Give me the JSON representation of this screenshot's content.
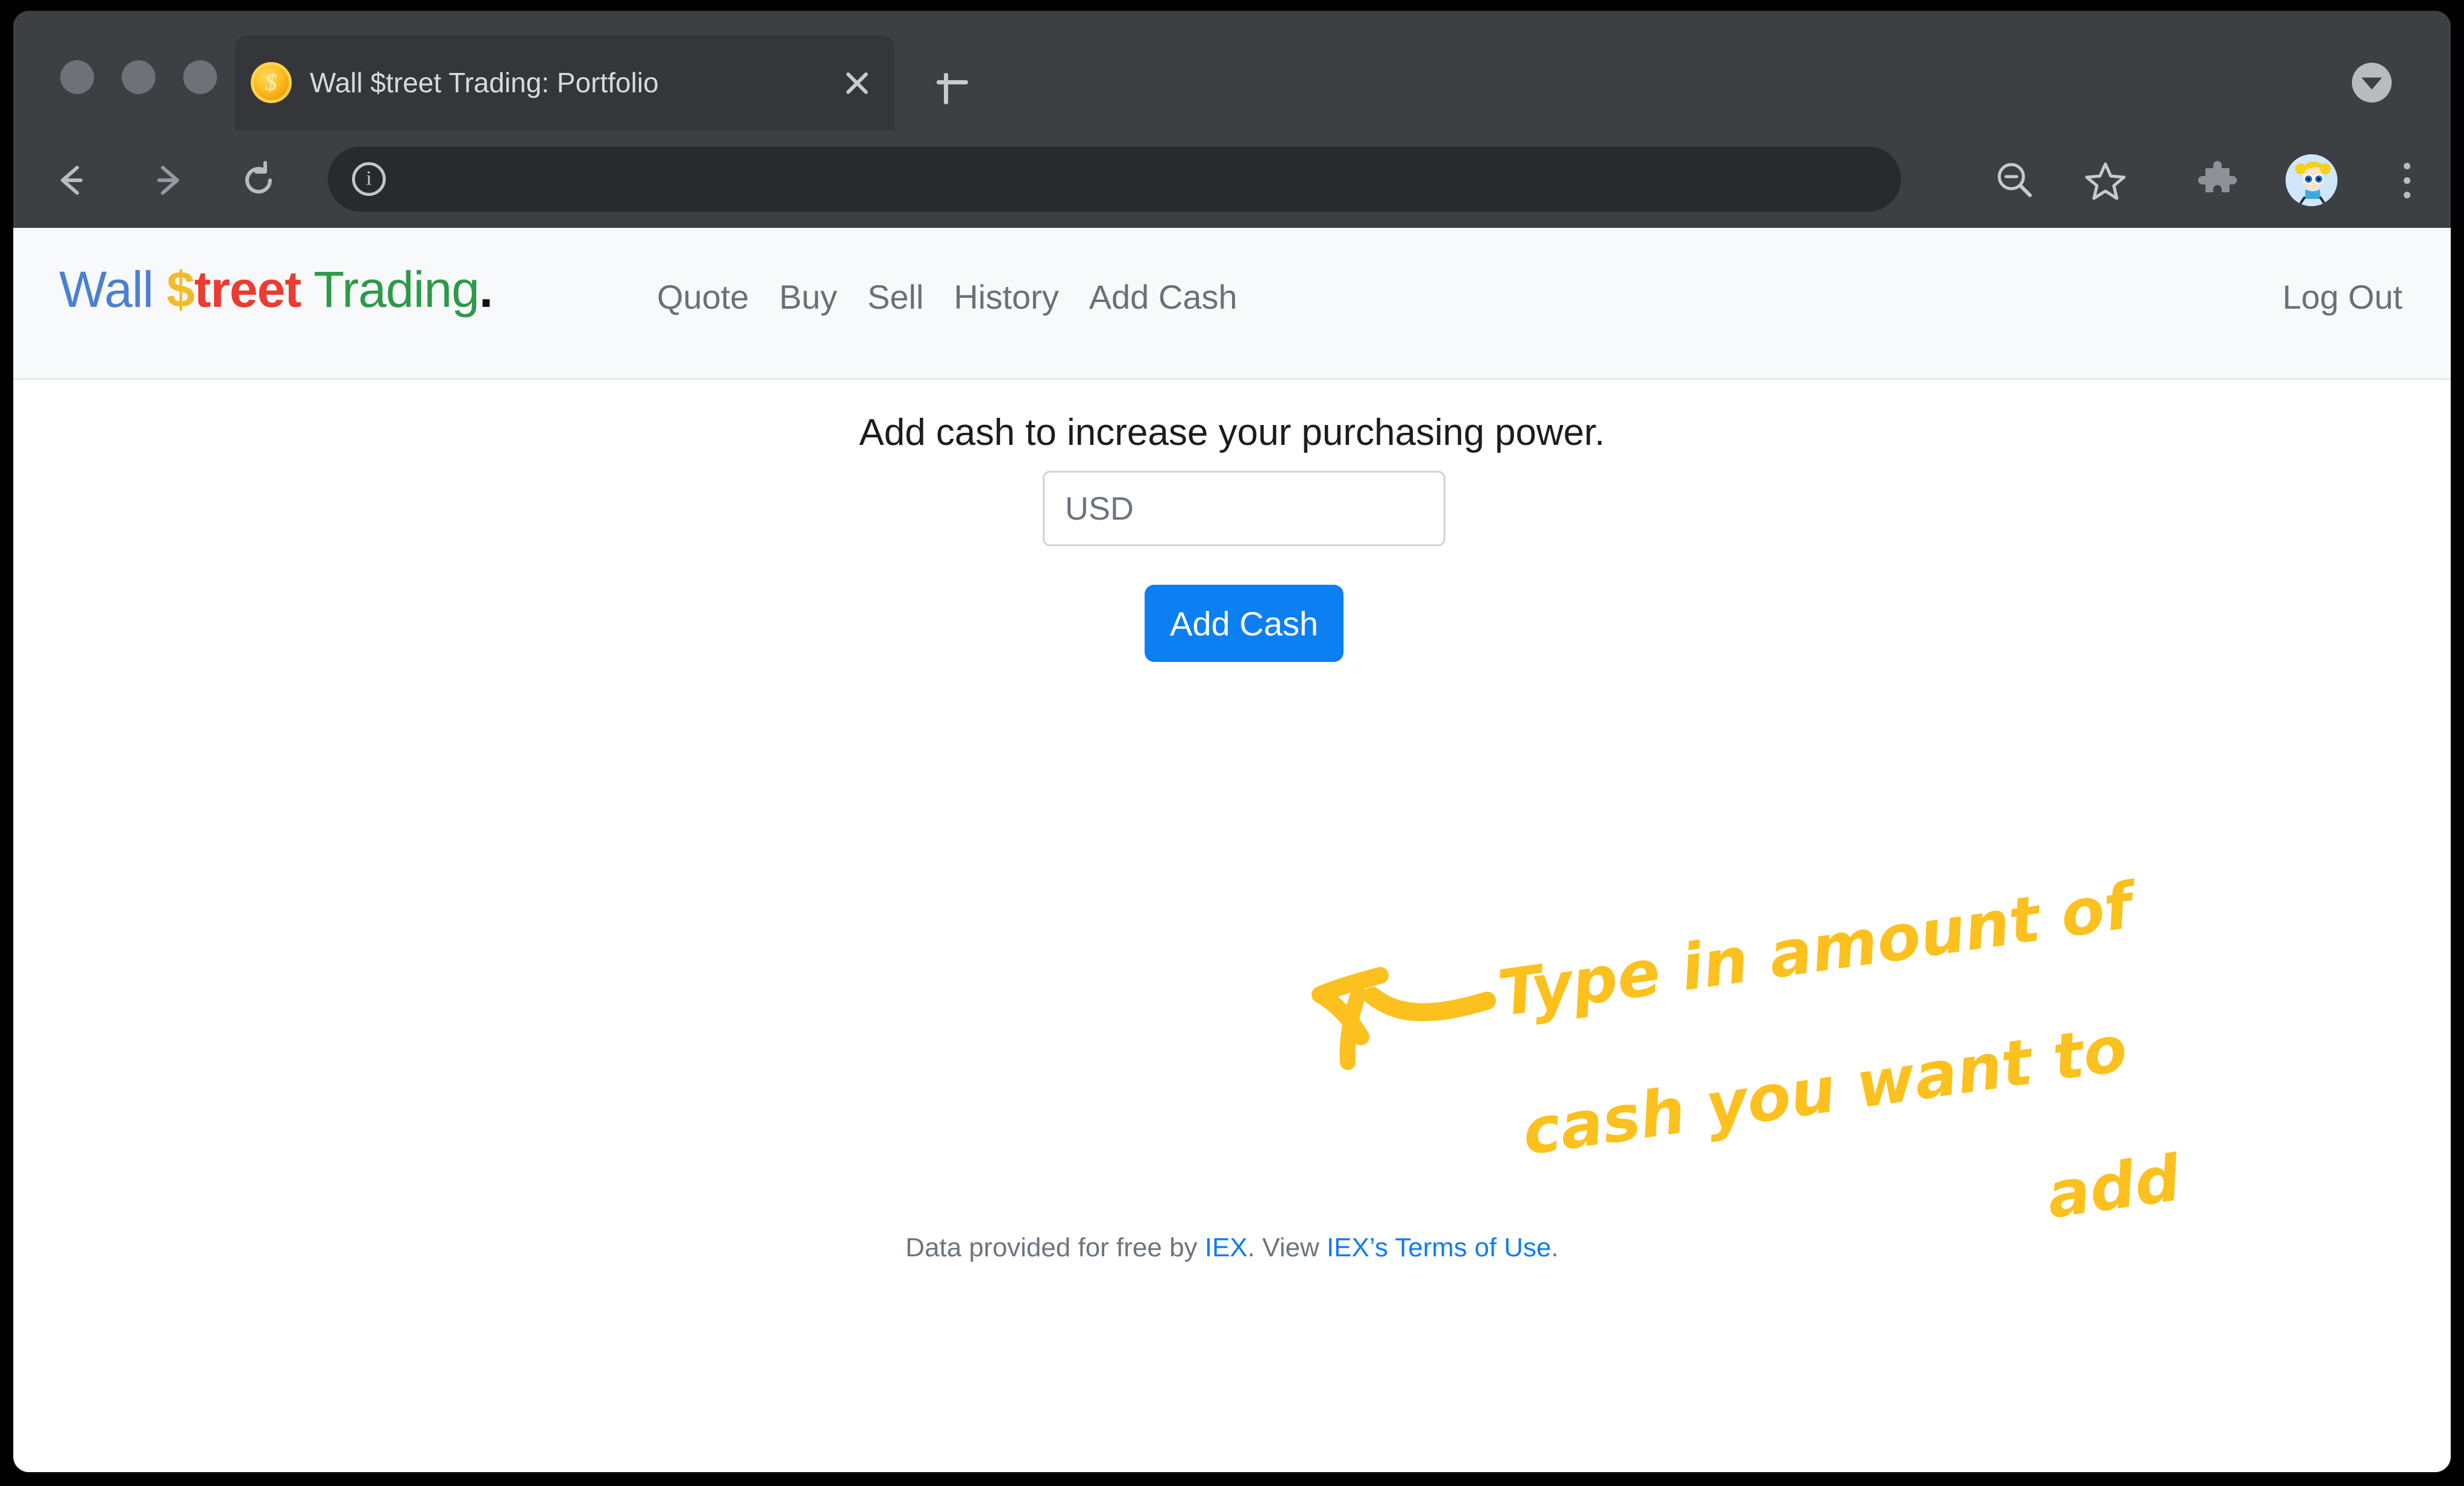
{
  "browser": {
    "tab": {
      "title": "Wall $treet Trading: Portfolio",
      "favicon": "gold-coin-dollar-icon",
      "close_label": "close-tab-icon"
    },
    "new_tab_label": "new-tab-icon",
    "tab_search_label": "tab-search-icon",
    "toolbar": {
      "back_label": "back-arrow-icon",
      "forward_label": "forward-arrow-icon",
      "reload_label": "reload-icon",
      "site_info_label": "site-info-icon",
      "url": "",
      "url_placeholder": "",
      "zoom_out_label": "zoom-out-icon",
      "bookmark_label": "bookmark-star-icon",
      "extensions_label": "extensions-puzzle-icon",
      "profile_label": "profile-avatar-icon",
      "menu_label": "three-dot-menu-icon"
    }
  },
  "site": {
    "brand": {
      "wall": "Wall ",
      "dollar": "$",
      "treet": "treet",
      "space": " ",
      "trading": "Trading",
      "dot": "."
    },
    "nav": [
      {
        "label": "Quote"
      },
      {
        "label": "Buy"
      },
      {
        "label": "Sell"
      },
      {
        "label": "History"
      },
      {
        "label": "Add Cash"
      }
    ],
    "logout_label": "Log Out"
  },
  "main": {
    "heading": "Add cash to increase your purchasing power.",
    "amount_input": {
      "value": "",
      "placeholder": "USD"
    },
    "submit_label": "Add Cash",
    "attribution": {
      "prefix": "Data provided for free by ",
      "link1": "IEX",
      "middle": ". View ",
      "link2": "IEX’s Terms of Use",
      "suffix": "."
    }
  },
  "annotation": {
    "line1": "Type in amount  of",
    "line2": "cash  you want to",
    "line3": "add",
    "arrow": "hand-drawn-arrow-to-input",
    "color": "#fcc11e"
  },
  "colors": {
    "brand_blue": "#4b7fd1",
    "brand_yellow": "#f2bb2c",
    "brand_red": "#ec3b30",
    "brand_green": "#2d9a49",
    "button_blue": "#0c7ff2",
    "link_blue": "#117bf5",
    "annotation_yellow": "#fcc11e",
    "chrome_dark": "#3c4043",
    "header_bg": "#f8f9fa"
  }
}
